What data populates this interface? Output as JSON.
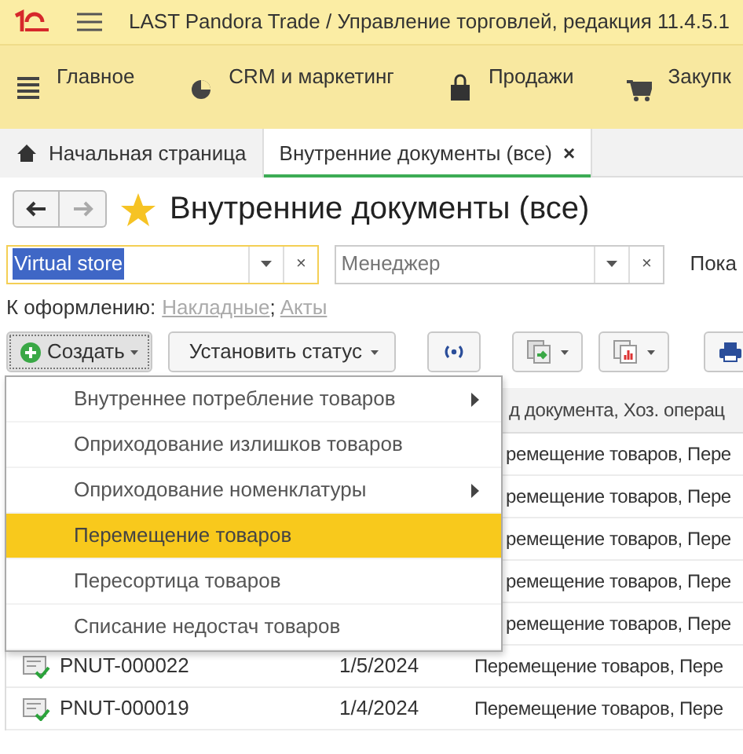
{
  "window": {
    "title": "LAST Pandora Trade / Управление торговлей, редакция 11.4.5.1"
  },
  "sections": [
    {
      "label": "Главное"
    },
    {
      "label": "CRM и маркетинг"
    },
    {
      "label": "Продажи"
    },
    {
      "label": "Закупк"
    }
  ],
  "tabs": [
    {
      "label": "Начальная страница",
      "kind": "home",
      "selected": false
    },
    {
      "label": "Внутренние документы (все)",
      "close": "×",
      "kind": "doc",
      "selected": true
    }
  ],
  "page": {
    "title": "Внутренние документы (все)"
  },
  "filters": [
    {
      "value": "Virtual store",
      "clear": "×"
    },
    {
      "placeholder": "Менеджер",
      "clear": "×"
    }
  ],
  "filter_cut_label": "Пока",
  "to_process": {
    "label": "К оформлению:",
    "links": [
      "Накладные",
      "Акты"
    ],
    "separator": ";"
  },
  "toolbar": {
    "create": "Создать",
    "set_status": "Установить статус"
  },
  "create_menu": [
    {
      "label": "Внутреннее потребление товаров",
      "submenu": true,
      "selected": false
    },
    {
      "label": "Оприходование излишков товаров",
      "submenu": false,
      "selected": false
    },
    {
      "label": "Оприходование номенклатуры",
      "submenu": true,
      "selected": false
    },
    {
      "label": "Перемещение товаров",
      "submenu": false,
      "selected": true
    },
    {
      "label": "Пересортица товаров",
      "submenu": false,
      "selected": false
    },
    {
      "label": "Списание недостач товаров",
      "submenu": false,
      "selected": false
    }
  ],
  "table": {
    "header_visible": "д документа, Хоз. операц",
    "rows": [
      {
        "kind": "covered",
        "operation": "ремещение товаров, Пере"
      },
      {
        "kind": "covered",
        "operation": "ремещение товаров, Пере"
      },
      {
        "kind": "covered",
        "operation": "ремещение товаров, Пере"
      },
      {
        "kind": "covered",
        "operation": "ремещение товаров, Пере"
      },
      {
        "kind": "covered",
        "operation": "ремещение товаров, Пере"
      },
      {
        "kind": "full",
        "number": "PNUT-000022",
        "date": "1/5/2024",
        "operation": "Перемещение товаров, Пере",
        "posted": true
      },
      {
        "kind": "full",
        "number": "PNUT-000019",
        "date": "1/4/2024",
        "operation": "Перемещение товаров, Пере",
        "posted": true
      }
    ]
  }
}
